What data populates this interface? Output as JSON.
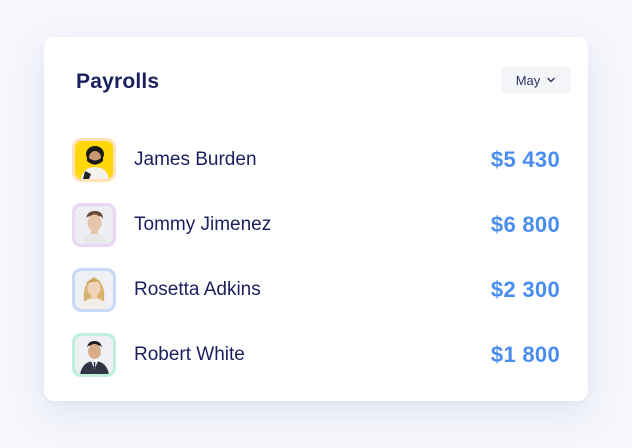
{
  "card": {
    "title": "Payrolls",
    "month": {
      "selected": "May",
      "icon": "chevron-down-icon"
    }
  },
  "payrolls": [
    {
      "name": "James Burden",
      "amount": "$5 430",
      "avatar_frame": "#ffe3b8",
      "avatar_bg": "#ffd70a"
    },
    {
      "name": "Tommy Jimenez",
      "amount": "$6 800",
      "avatar_frame": "#ebd6f5",
      "avatar_bg": "#eceef2"
    },
    {
      "name": "Rosetta Adkins",
      "amount": "$2 300",
      "avatar_frame": "#c8daf7",
      "avatar_bg": "#eef0f4"
    },
    {
      "name": "Robert White",
      "amount": "$1 800",
      "avatar_frame": "#bff0dd",
      "avatar_bg": "#eef0f3"
    }
  ],
  "colors": {
    "title": "#1b1f5e",
    "amount": "#4a8df0",
    "card_bg": "#ffffff",
    "page_bg": "#f6f7fc"
  }
}
